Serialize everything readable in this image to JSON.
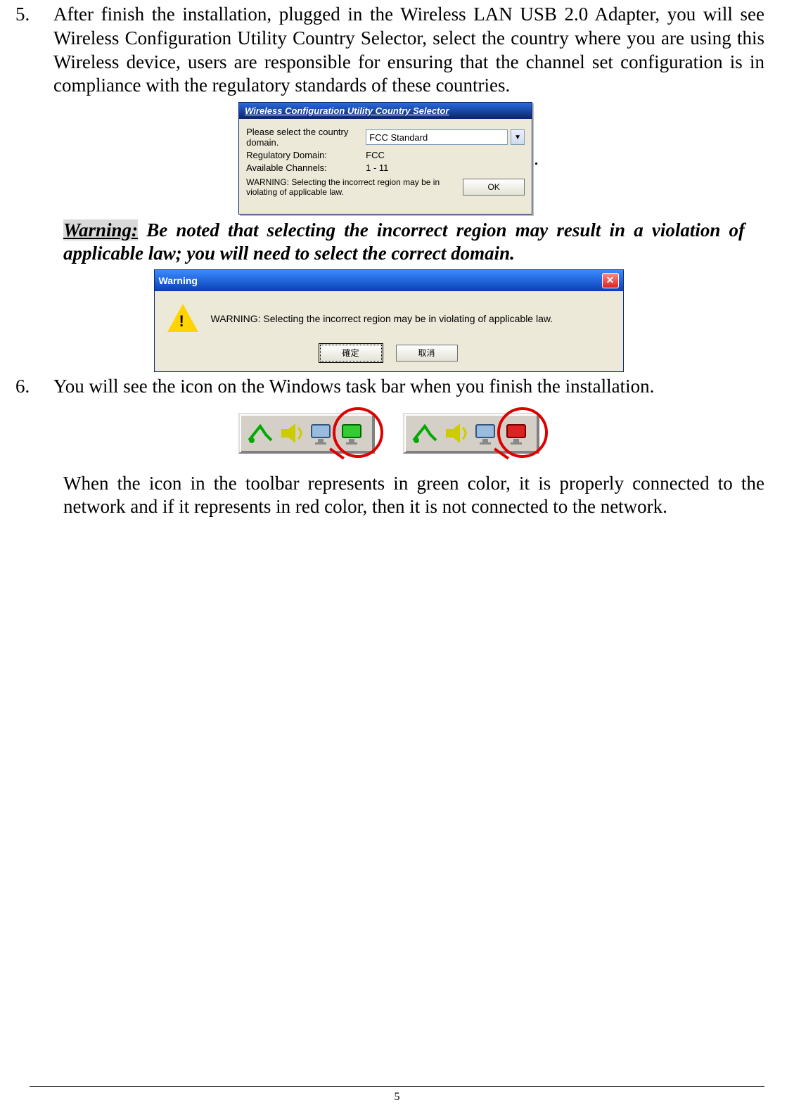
{
  "step5": {
    "num": "5.",
    "text": "After finish the installation, plugged in the Wireless LAN USB 2.0 Adapter, you will see Wireless Configuration Utility Country Selector, select the country where you are using this Wireless device, users are responsible for ensuring that the channel set configuration is in compliance with the regulatory standards of these countries."
  },
  "selector_dialog": {
    "title": "Wireless Configuration Utility Country Selector",
    "label_country": "Please select the country domain.",
    "combo_value": "FCC Standard",
    "label_regdom": "Regulatory Domain:",
    "value_regdom": "FCC",
    "label_channels": "Available Channels:",
    "value_channels": "1 - 11",
    "warn_text": "WARNING: Selecting the incorrect region may be in violating of applicable law.",
    "ok": "OK"
  },
  "selector_trailing_dot": ".",
  "warning_para": {
    "lead": "Warning:",
    "rest": " Be noted that selecting the incorrect region may result in a violation of applicable law; you will need to select the correct domain."
  },
  "msgbox": {
    "title": "Warning",
    "body": "WARNING: Selecting the incorrect region may be in violating of applicable law.",
    "btn_ok": "確定",
    "btn_cancel": "取消"
  },
  "step6": {
    "num": "6.",
    "text": "You will see the icon on the Windows task bar when you finish the installation."
  },
  "tray_desc": "When the icon in the toolbar represents in green color, it is properly connected to the network and if it represents in red color, then it is not connected to the network.",
  "page_number": "5"
}
